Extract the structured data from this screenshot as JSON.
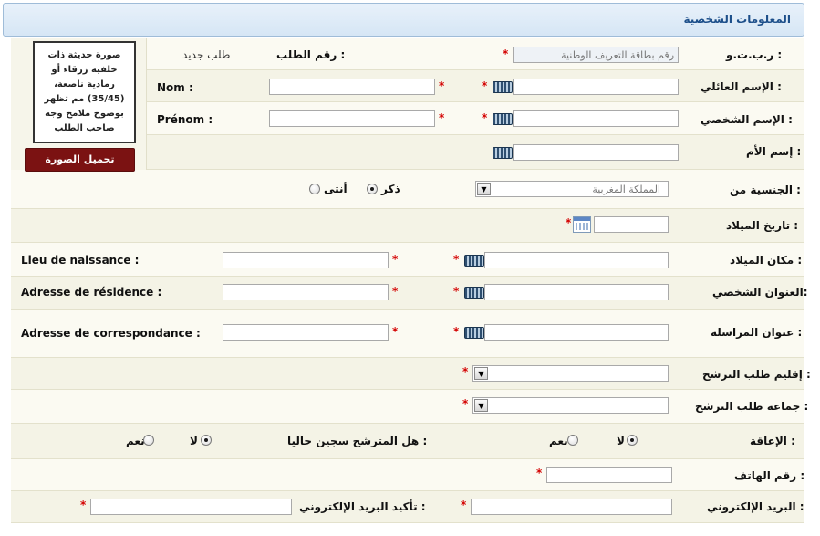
{
  "section": {
    "title": "المعلومات الشخصية"
  },
  "photo": {
    "instructions": "صورة حديثة ذات خلفية زرقاء أو رمادية ناصعة،(35/45) مم تظهر بوضوح ملامح وجه صاحب الطلب",
    "upload_label": "تحميل الصورة"
  },
  "fields": {
    "cin": {
      "label": "ر.ب.ت.و :",
      "placeholder": "رقم بطاقة التعريف الوطنية",
      "required": "*"
    },
    "request_number": {
      "label": "رقم الطلب :",
      "value": "طلب جديد"
    },
    "family_name": {
      "label": "الإسم العائلي :",
      "required": "*",
      "fr_label": "Nom :",
      "fr_required": "*"
    },
    "first_name": {
      "label": "الإسم الشخصي :",
      "required": "*",
      "fr_label": "Prénom :",
      "fr_required": "*"
    },
    "mother_name": {
      "label": "إسم الأم :"
    },
    "nationality": {
      "label": "الجنسية من :",
      "value": "المملكة المغربية"
    },
    "gender": {
      "male": "ذكر",
      "female": "أنثى",
      "selected": "male"
    },
    "birth_date": {
      "label": "تاريخ الميلاد :",
      "required": "*"
    },
    "birth_place": {
      "label": "مكان الميلاد :",
      "required": "*",
      "fr_label": "Lieu de naissance :",
      "fr_required": "*"
    },
    "address": {
      "label": "العنوان الشخصي:",
      "required": "*",
      "fr_label": "Adresse de résidence :",
      "fr_required": "*"
    },
    "mailing_address": {
      "label": "عنوان المراسلة :",
      "required": "*",
      "fr_label": "Adresse de correspondance :",
      "fr_required": "*"
    },
    "region": {
      "label": "إقليم طلب الترشح :",
      "required": "*"
    },
    "commune": {
      "label": "جماعة طلب الترشح :",
      "required": "*"
    },
    "disability": {
      "label": "الإعاقة :",
      "no": "لا",
      "yes": "نعم",
      "selected": "no"
    },
    "prisoner": {
      "label": "هل المترشح سجين حاليا :",
      "no": "لا",
      "yes": "نعم",
      "selected": "no"
    },
    "phone": {
      "label": "رقم الهاتف :",
      "required": "*"
    },
    "email": {
      "label": "البريد الإلكتروني :",
      "required": "*"
    },
    "email_confirm": {
      "label": "تأكيد البريد الإلكتروني :",
      "required": "*"
    }
  },
  "icons": {
    "keyboard": "keyboard-icon",
    "calendar": "calendar-icon",
    "dropdown": "chevron-down-icon"
  }
}
